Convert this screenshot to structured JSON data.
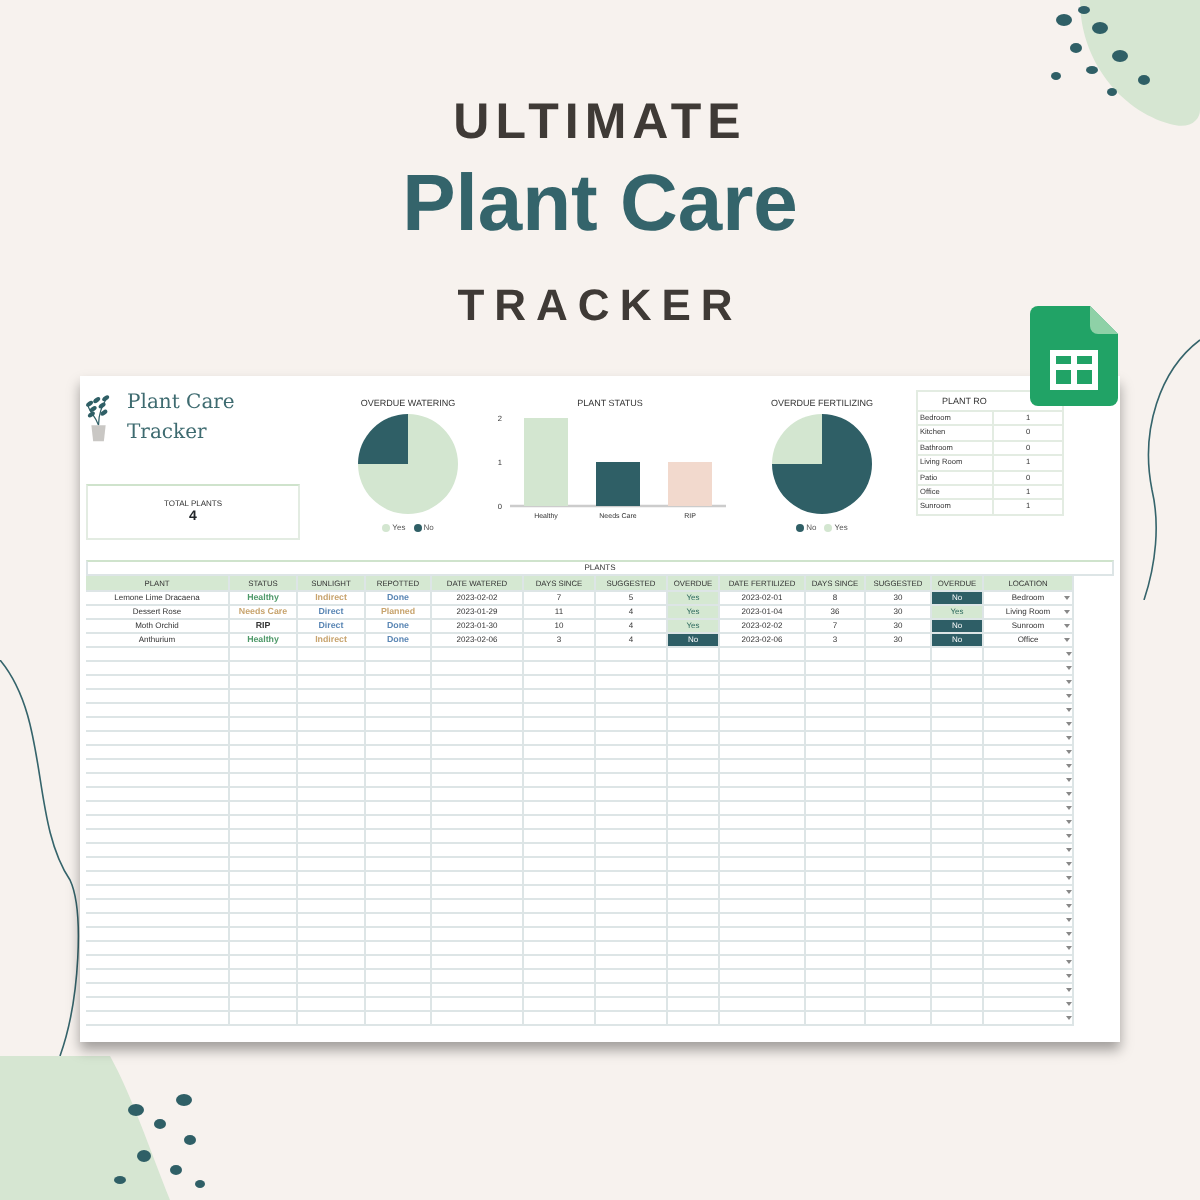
{
  "heading": {
    "line_1": "ULTIMATE",
    "line_2": "Plant Care",
    "line_3": "TRACKER"
  },
  "sheet": {
    "title": "Plant Care Tracker",
    "total": {
      "label": "TOTAL PLANTS",
      "value": "4"
    },
    "charts": [
      {
        "chart_data": {
          "type": "pie",
          "title": "OVERDUE WATERING",
          "categories": [
            "Yes",
            "No"
          ],
          "values": [
            75,
            25
          ],
          "colors": [
            "#d3e6d0",
            "#2f5f66"
          ],
          "legend": "bottom"
        }
      },
      {
        "chart_data": {
          "type": "bar",
          "title": "PLANT STATUS",
          "categories": [
            "Healthy",
            "Needs Care",
            "RIP"
          ],
          "values": [
            2,
            1,
            1
          ],
          "colors": [
            "#d3e6d0",
            "#2f5f66",
            "#f2d9cd"
          ],
          "ylim": [
            0,
            2
          ],
          "yticks": [
            0,
            1,
            2
          ]
        }
      },
      {
        "chart_data": {
          "type": "pie",
          "title": "OVERDUE FERTILIZING",
          "categories": [
            "No",
            "Yes"
          ],
          "values": [
            75,
            25
          ],
          "colors": [
            "#2f5f66",
            "#d3e6d0"
          ],
          "legend": "bottom"
        }
      }
    ],
    "rooms": {
      "title": "PLANT RO",
      "rows": [
        {
          "room": "Bedroom",
          "count": "1"
        },
        {
          "room": "Kitchen",
          "count": "0"
        },
        {
          "room": "Bathroom",
          "count": "0"
        },
        {
          "room": "Living Room",
          "count": "1"
        },
        {
          "room": "Patio",
          "count": "0"
        },
        {
          "room": "Office",
          "count": "1"
        },
        {
          "room": "Sunroom",
          "count": "1"
        }
      ]
    },
    "plants": {
      "title": "PLANTS",
      "columns": [
        "PLANT",
        "STATUS",
        "SUNLIGHT",
        "REPOTTED",
        "DATE WATERED",
        "DAYS SINCE",
        "SUGGESTED",
        "OVERDUE",
        "DATE FERTILIZED",
        "DAYS SINCE",
        "SUGGESTED",
        "OVERDUE",
        "LOCATION"
      ],
      "rows": [
        {
          "cells": [
            {
              "text": "Lemone Lime Dracaena"
            },
            {
              "text": "Healthy",
              "color": "#4f9a6a"
            },
            {
              "text": "Indirect",
              "color": "#c8a46e"
            },
            {
              "text": "Done",
              "color": "#5b87b5"
            },
            {
              "text": "2023-02-02"
            },
            {
              "text": "7"
            },
            {
              "text": "5"
            },
            {
              "text": "Yes",
              "kind": "filled",
              "color": "#d5e8d2"
            },
            {
              "text": "2023-02-01"
            },
            {
              "text": "8"
            },
            {
              "text": "30"
            },
            {
              "text": "No",
              "kind": "filled",
              "color": "#2e5e66"
            },
            {
              "text": "Bedroom",
              "kind": "dropdown"
            }
          ]
        },
        {
          "cells": [
            {
              "text": "Dessert Rose"
            },
            {
              "text": "Needs Care",
              "color": "#c8a46e"
            },
            {
              "text": "Direct",
              "color": "#5b87b5"
            },
            {
              "text": "Planned",
              "color": "#c8a46e"
            },
            {
              "text": "2023-01-29"
            },
            {
              "text": "11"
            },
            {
              "text": "4"
            },
            {
              "text": "Yes",
              "kind": "filled",
              "color": "#d5e8d2"
            },
            {
              "text": "2023-01-04"
            },
            {
              "text": "36"
            },
            {
              "text": "30"
            },
            {
              "text": "Yes",
              "kind": "filled",
              "color": "#d5e8d2"
            },
            {
              "text": "Living Room",
              "kind": "dropdown"
            }
          ]
        },
        {
          "cells": [
            {
              "text": "Moth Orchid"
            },
            {
              "text": "RIP",
              "color": "#333333"
            },
            {
              "text": "Direct",
              "color": "#5b87b5"
            },
            {
              "text": "Done",
              "color": "#5b87b5"
            },
            {
              "text": "2023-01-30"
            },
            {
              "text": "10"
            },
            {
              "text": "4"
            },
            {
              "text": "Yes",
              "kind": "filled",
              "color": "#d5e8d2"
            },
            {
              "text": "2023-02-02"
            },
            {
              "text": "7"
            },
            {
              "text": "30"
            },
            {
              "text": "No",
              "kind": "filled",
              "color": "#2e5e66"
            },
            {
              "text": "Sunroom",
              "kind": "dropdown"
            }
          ]
        },
        {
          "cells": [
            {
              "text": "Anthurium"
            },
            {
              "text": "Healthy",
              "color": "#4f9a6a"
            },
            {
              "text": "Indirect",
              "color": "#c8a46e"
            },
            {
              "text": "Done",
              "color": "#5b87b5"
            },
            {
              "text": "2023-02-06"
            },
            {
              "text": "3"
            },
            {
              "text": "4"
            },
            {
              "text": "No",
              "kind": "filled",
              "color": "#2e5e66"
            },
            {
              "text": "2023-02-06"
            },
            {
              "text": "3"
            },
            {
              "text": "30"
            },
            {
              "text": "No",
              "kind": "filled",
              "color": "#2e5e66"
            },
            {
              "text": "Office",
              "kind": "dropdown"
            }
          ]
        }
      ]
    }
  }
}
